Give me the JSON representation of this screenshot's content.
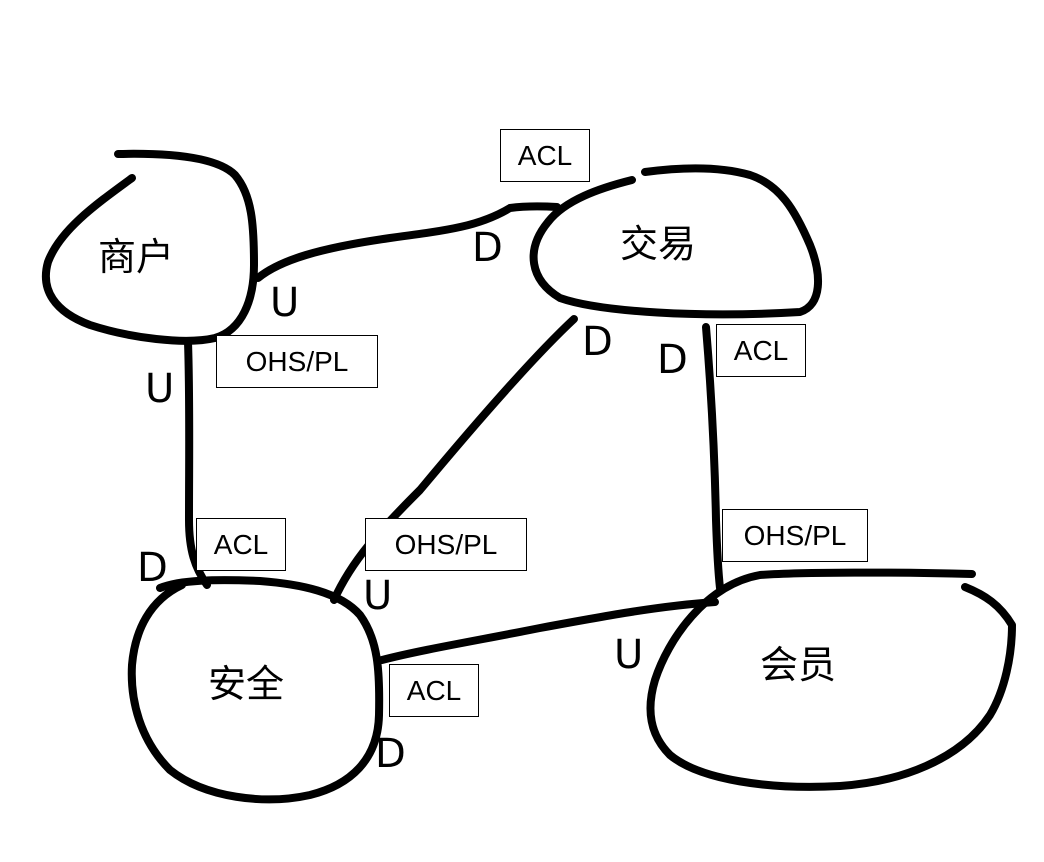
{
  "contexts": {
    "merchant": "商户",
    "trade": "交易",
    "security": "安全",
    "member": "会员"
  },
  "relations": {
    "merchant_trade": {
      "upstream": "U",
      "downstream": "D",
      "pattern": "ACL"
    },
    "merchant_security": {
      "upstream": "U",
      "upstream_pattern": "OHS/PL",
      "downstream": "D",
      "downstream_pattern": "ACL"
    },
    "trade_security": {
      "downstream": "D",
      "upstream": "U",
      "pattern": "OHS/PL"
    },
    "trade_member": {
      "downstream": "D",
      "downstream_pattern": "ACL",
      "upstream_pattern": "OHS/PL"
    },
    "security_member": {
      "upstream": "U",
      "downstream": "D",
      "pattern": "ACL"
    }
  }
}
